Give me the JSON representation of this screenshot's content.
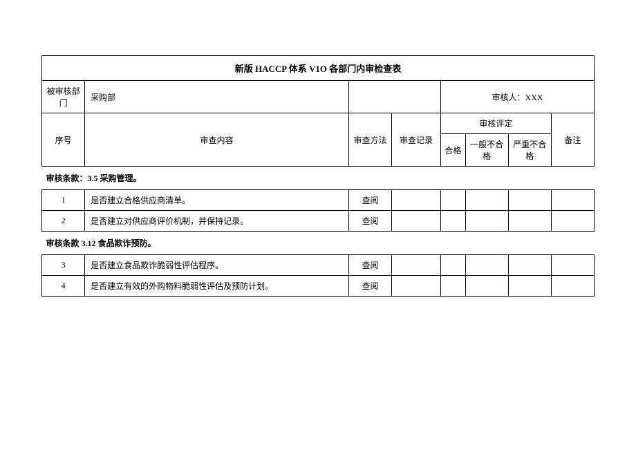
{
  "title": "新版 HACCP 体系 V1O 各部门内审检查表",
  "meta": {
    "dept_label": "被审核部门",
    "dept_value": "采购部",
    "auditor_label": "审核人：",
    "auditor_value": "XXX"
  },
  "headers": {
    "seq": "序号",
    "content": "审查内容",
    "method": "审查方法",
    "record": "审查记录",
    "rating_group": "审核评定",
    "rating_pass": "合格",
    "rating_fail": "一般不合格",
    "rating_major": "严重不合格",
    "note": "备注"
  },
  "sections": [
    {
      "label": "审核条款：3.5 采购管理。",
      "rows": [
        {
          "seq": "1",
          "content": "是否建立合格供应商清单。",
          "method": "查阅"
        },
        {
          "seq": "2",
          "content": "是否建立对供应商评价机制，并保持记录。",
          "method": "查阅"
        }
      ]
    },
    {
      "label": "审核条款 3.12 食品欺诈预防。",
      "rows": [
        {
          "seq": "3",
          "content": "是否建立食品欺诈脆弱性评估程序。",
          "method": "查阅"
        },
        {
          "seq": "4",
          "content": "是否建立有效的外购物料脆弱性评估及预防计划。",
          "method": "查阅"
        }
      ]
    }
  ]
}
